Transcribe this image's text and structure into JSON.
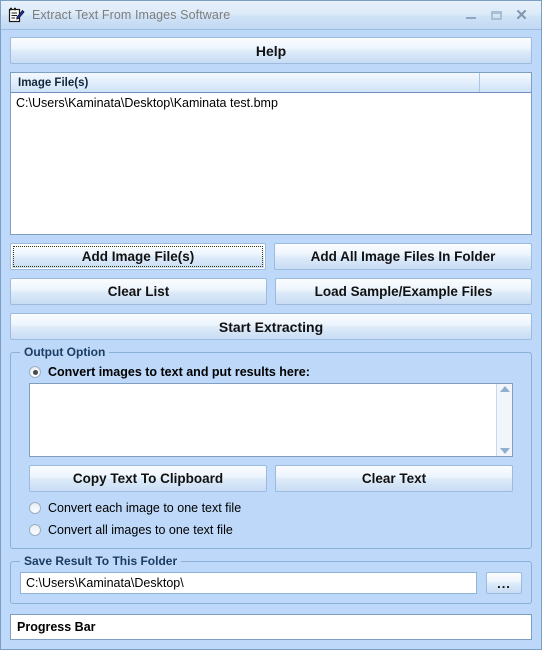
{
  "window": {
    "title": "Extract Text From Images Software",
    "icon": "notepad-pencil-icon",
    "controls": {
      "minimize": "minimize-icon",
      "maximize": "maximize-icon",
      "close": "close-icon"
    }
  },
  "toolbar": {
    "help_label": "Help"
  },
  "file_list": {
    "columns": [
      "Image File(s)",
      ""
    ],
    "rows": [
      "C:\\Users\\Kaminata\\Desktop\\Kaminata test.bmp"
    ]
  },
  "actions": {
    "add_image_files": "Add Image File(s)",
    "add_all_in_folder": "Add All Image Files In Folder",
    "clear_list": "Clear List",
    "load_samples": "Load Sample/Example Files",
    "start_extracting": "Start Extracting"
  },
  "output_option": {
    "group_title": "Output Option",
    "option_put_results_here": "Convert images to text and put results here:",
    "result_text": "",
    "copy_to_clipboard": "Copy Text To Clipboard",
    "clear_text": "Clear Text",
    "option_each_image": "Convert each image to one text file",
    "option_all_images": "Convert all images to one text file",
    "selected": "option_put_results_here"
  },
  "save_folder": {
    "group_title": "Save Result To This Folder",
    "path": "C:\\Users\\Kaminata\\Desktop\\",
    "browse_label": "..."
  },
  "status": {
    "progress_label": "Progress Bar"
  },
  "colors": {
    "window_background": "#bdd8f8",
    "titlebar_top": "#e8f1fb",
    "border": "#7a9fc4",
    "group_title_text": "#1d3c62"
  }
}
